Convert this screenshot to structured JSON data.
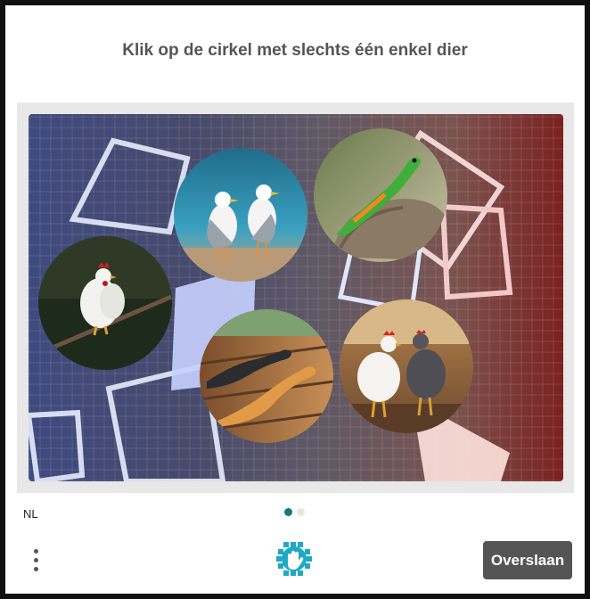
{
  "prompt": "Klik op de cirkel met slechts één enkel dier",
  "challenge": {
    "images": [
      {
        "id": "rooster",
        "label": "rooster-on-branch"
      },
      {
        "id": "seagulls",
        "label": "two-seagulls"
      },
      {
        "id": "lizard",
        "label": "green-lizard-on-rock"
      },
      {
        "id": "lizards",
        "label": "two-lizards-on-bench"
      },
      {
        "id": "chickens",
        "label": "two-chickens"
      }
    ]
  },
  "footer": {
    "language": "NL",
    "skip_label": "Overslaan"
  },
  "pagination": {
    "current": 1,
    "total": 2
  },
  "colors": {
    "accent": "#0b7d7a",
    "button": "#555555",
    "logo": "#1ea9c5"
  },
  "icons": {
    "menu": "vertical-ellipsis-icon",
    "logo": "hcaptcha-hand-icon"
  }
}
